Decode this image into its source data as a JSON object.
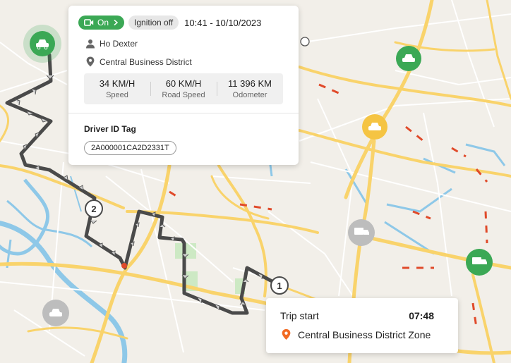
{
  "vehicle_status": {
    "camera_label": "On",
    "ignition_label": "Ignition off",
    "datetime": "10:41 - 10/10/2023",
    "driver_name": "Ho Dexter",
    "location": "Central Business District"
  },
  "stats": [
    {
      "value": "34 KM/H",
      "label": "Speed"
    },
    {
      "value": "60 KM/H",
      "label": "Road Speed"
    },
    {
      "value": "11 396 KM",
      "label": "Odometer"
    }
  ],
  "driver_tag": {
    "title": "Driver ID Tag",
    "value": "2A000001CA2D2331T"
  },
  "trip": {
    "title": "Trip start",
    "time": "07:48",
    "location": "Central Business District Zone"
  },
  "waypoints": [
    {
      "label": "1"
    },
    {
      "label": "2"
    }
  ],
  "colors": {
    "active_green": "#3ba855",
    "idle_yellow": "#f5c443",
    "offline_grey": "#bdbdbd",
    "route": "#4a4a4a",
    "road_major": "#f9d36b",
    "water": "#8ec8e8",
    "park": "#cde9c4",
    "traffic_red": "#e04a2a",
    "pin_orange": "#f26a22"
  }
}
